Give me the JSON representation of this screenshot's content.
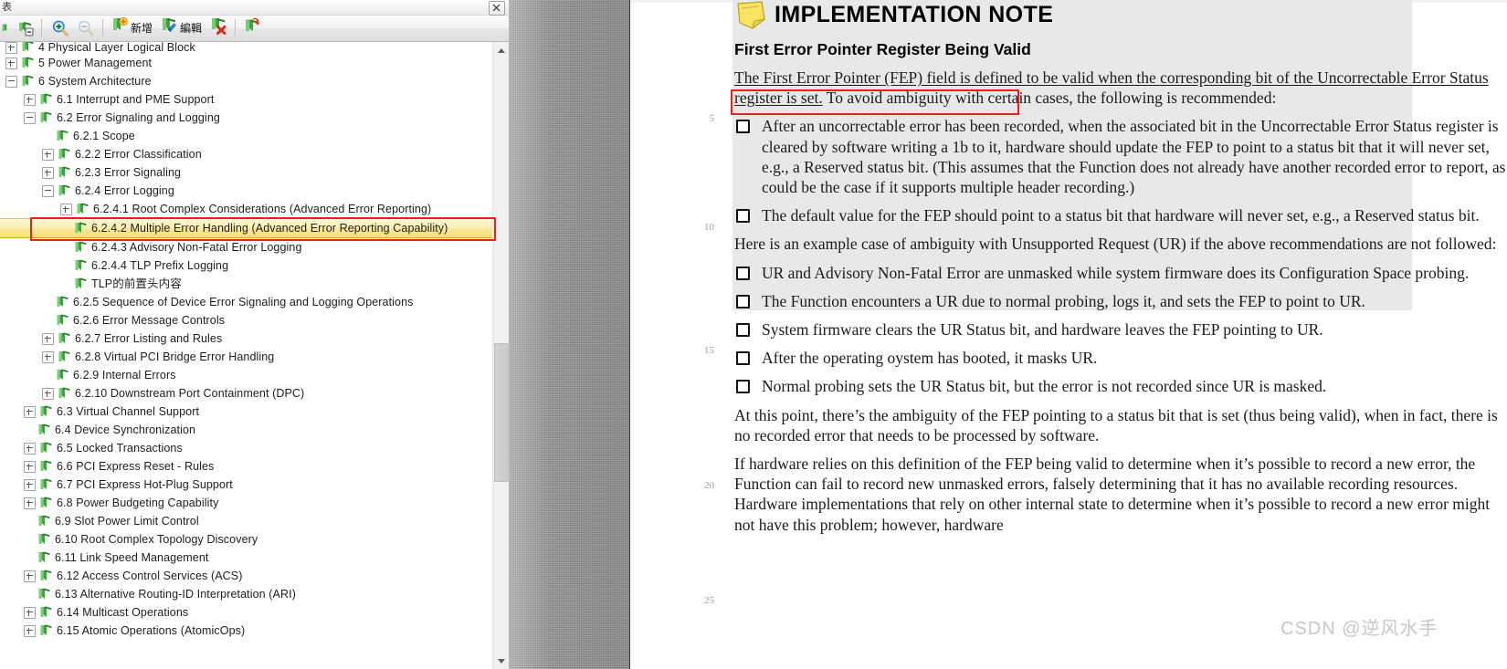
{
  "panel": {
    "title": "表",
    "close_label": "×",
    "toolbar": {
      "buttons": [
        {
          "name": "bookmark-list-icon",
          "label": "",
          "icon": "bookmark-list"
        },
        {
          "name": "bookmark-collapse-icon",
          "label": "",
          "icon": "bookmark-collapse"
        },
        {
          "name": "zoom-in-icon",
          "label": "",
          "icon": "zoom-in"
        },
        {
          "name": "zoom-out-icon",
          "label": "",
          "icon": "zoom-out"
        },
        {
          "name": "add-bookmark-button",
          "label": "新增",
          "icon": "bookmark-add"
        },
        {
          "name": "edit-bookmark-button",
          "label": "編輯",
          "icon": "bookmark-edit"
        },
        {
          "name": "delete-bookmark-button",
          "label": "",
          "icon": "bookmark-delete"
        },
        {
          "name": "goto-bookmark-button",
          "label": "",
          "icon": "bookmark-goto"
        }
      ]
    }
  },
  "tree": {
    "items": [
      {
        "level": 0,
        "toggle": "plus",
        "label": "4 Physical Layer Logical Block",
        "selected": false,
        "clipped": true
      },
      {
        "level": 0,
        "toggle": "plus",
        "label": "5 Power Management",
        "selected": false
      },
      {
        "level": 0,
        "toggle": "minus",
        "label": "6 System Architecture",
        "selected": false
      },
      {
        "level": 1,
        "toggle": "plus",
        "label": "6.1 Interrupt and PME Support",
        "selected": false
      },
      {
        "level": 1,
        "toggle": "minus",
        "label": "6.2 Error Signaling and Logging",
        "selected": false
      },
      {
        "level": 2,
        "toggle": "none",
        "label": "6.2.1 Scope",
        "selected": false
      },
      {
        "level": 2,
        "toggle": "plus",
        "label": "6.2.2 Error Classification",
        "selected": false
      },
      {
        "level": 2,
        "toggle": "plus",
        "label": "6.2.3 Error Signaling",
        "selected": false
      },
      {
        "level": 2,
        "toggle": "minus",
        "label": "6.2.4 Error Logging",
        "selected": false
      },
      {
        "level": 3,
        "toggle": "plus",
        "label": "6.2.4.1 Root Complex Considerations (Advanced Error Reporting)",
        "selected": false
      },
      {
        "level": 3,
        "toggle": "none",
        "label": "6.2.4.2 Multiple Error Handling (Advanced Error Reporting Capability)",
        "selected": true
      },
      {
        "level": 3,
        "toggle": "none",
        "label": "6.2.4.3 Advisory Non-Fatal Error Logging",
        "selected": false
      },
      {
        "level": 3,
        "toggle": "none",
        "label": "6.2.4.4 TLP Prefix Logging",
        "selected": false
      },
      {
        "level": 3,
        "toggle": "none",
        "label": "TLP的前置头内容",
        "selected": false
      },
      {
        "level": 2,
        "toggle": "none",
        "label": "6.2.5 Sequence of Device Error Signaling and Logging Operations",
        "selected": false
      },
      {
        "level": 2,
        "toggle": "none",
        "label": "6.2.6 Error Message Controls",
        "selected": false
      },
      {
        "level": 2,
        "toggle": "plus",
        "label": "6.2.7 Error Listing and Rules",
        "selected": false
      },
      {
        "level": 2,
        "toggle": "plus",
        "label": "6.2.8 Virtual PCI Bridge Error Handling",
        "selected": false
      },
      {
        "level": 2,
        "toggle": "none",
        "label": "6.2.9 Internal Errors",
        "selected": false
      },
      {
        "level": 2,
        "toggle": "plus",
        "label": "6.2.10 Downstream Port Containment (DPC)",
        "selected": false
      },
      {
        "level": 1,
        "toggle": "plus",
        "label": "6.3 Virtual Channel Support",
        "selected": false
      },
      {
        "level": 1,
        "toggle": "none",
        "label": "6.4 Device Synchronization",
        "selected": false
      },
      {
        "level": 1,
        "toggle": "plus",
        "label": "6.5 Locked Transactions",
        "selected": false
      },
      {
        "level": 1,
        "toggle": "plus",
        "label": "6.6 PCI Express Reset - Rules",
        "selected": false
      },
      {
        "level": 1,
        "toggle": "plus",
        "label": "6.7 PCI Express Hot-Plug Support",
        "selected": false
      },
      {
        "level": 1,
        "toggle": "plus",
        "label": "6.8 Power Budgeting Capability",
        "selected": false
      },
      {
        "level": 1,
        "toggle": "none",
        "label": "6.9 Slot Power Limit Control",
        "selected": false
      },
      {
        "level": 1,
        "toggle": "none",
        "label": "6.10 Root Complex Topology Discovery",
        "selected": false
      },
      {
        "level": 1,
        "toggle": "none",
        "label": "6.11 Link Speed Management",
        "selected": false
      },
      {
        "level": 1,
        "toggle": "plus",
        "label": "6.12 Access Control Services (ACS)",
        "selected": false
      },
      {
        "level": 1,
        "toggle": "none",
        "label": "6.13 Alternative Routing-ID Interpretation (ARI)",
        "selected": false
      },
      {
        "level": 1,
        "toggle": "plus",
        "label": "6.14 Multicast Operations",
        "selected": false
      },
      {
        "level": 1,
        "toggle": "plus",
        "label": "6.15 Atomic Operations (AtomicOps)",
        "selected": false
      }
    ]
  },
  "document": {
    "note_title": "IMPLEMENTATION NOTE",
    "note_subtitle": "First Error Pointer Register Being Valid",
    "line_numbers": [
      "5",
      "10",
      "15",
      "20",
      "25"
    ],
    "intro_underlined": "The First Error Pointer (FEP) field is defined to be valid when the corresponding bit of the Uncorrectable Error Status register is set.",
    "intro_rest": " To avoid ambiguity with certain cases, the following is recommended:",
    "bullets_1": [
      "After an uncorrectable error has been recorded, when the associated bit in the Uncorrectable Error Status register is cleared by software writing a 1b to it, hardware should update the FEP to point to a status bit that it will never set, e.g., a Reserved status bit.  (This assumes that the Function does not already have another recorded error to report, as could be the case if it supports multiple header recording.)",
      "The default value for the FEP should point to a status bit that hardware will never set, e.g., a Reserved status bit."
    ],
    "para_example": "Here is an example case of ambiguity with Unsupported Request (UR) if the above recommendations are not followed:",
    "bullets_2": [
      "UR and Advisory Non-Fatal Error are unmasked while system firmware does its Configuration Space probing.",
      "The Function encounters a UR due to normal probing, logs it, and sets the FEP to point to UR.",
      "System firmware clears the UR Status bit, and hardware leaves the FEP pointing to UR.",
      "After the operating oystem has booted, it masks UR.",
      "Normal probing sets the UR Status bit, but the error is not recorded since UR is masked."
    ],
    "para_atthispoint": "At this point, there’s the ambiguity of the FEP pointing to a status bit that is set (thus being valid), when in fact, there is no recorded error that needs to be processed by software.",
    "para_ifhardware": "If hardware relies on this definition of the FEP being valid to determine when it’s possible to record a new error, the Function can fail to record new unmasked errors, falsely determining that it has no available recording resources.  Hardware implementations that rely on other internal state to determine when it’s possible to record a new error might not have this problem; however, hardware",
    "watermark": "CSDN @逆风水手"
  },
  "colors": {
    "highlight_red": "#e8201c",
    "selection_gold": "#f7dd7d",
    "note_band": "#e8e8e8",
    "gutter": "#8d8d8d"
  }
}
